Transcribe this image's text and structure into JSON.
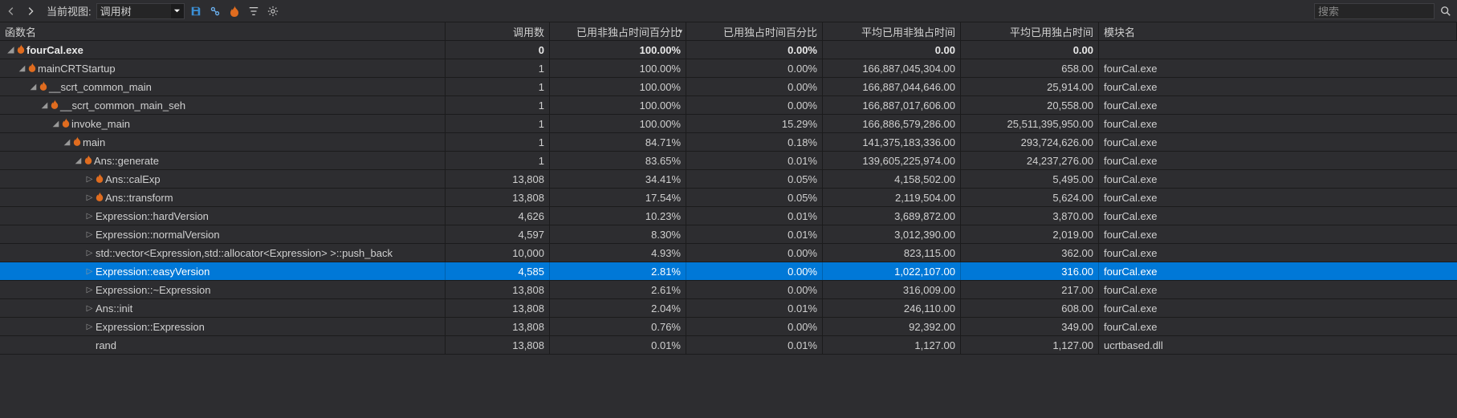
{
  "toolbar": {
    "view_label": "当前视图:",
    "view_value": "调用树",
    "search_placeholder": "搜索"
  },
  "columns": {
    "fn": "函数名",
    "calls": "调用数",
    "elap": "已用非独占时间百分比",
    "excl": "已用独占时间百分比",
    "avel": "平均已用非独占时间",
    "avex": "平均已用独占时间",
    "mod": "模块名"
  },
  "rows": [
    {
      "depth": 0,
      "exp": "open",
      "fire": true,
      "fn": "fourCal.exe",
      "calls": "0",
      "elap": "100.00%",
      "excl": "0.00%",
      "avel": "0.00",
      "avex": "0.00",
      "mod": "",
      "top": true
    },
    {
      "depth": 1,
      "exp": "open",
      "fire": true,
      "fn": "mainCRTStartup",
      "calls": "1",
      "elap": "100.00%",
      "excl": "0.00%",
      "avel": "166,887,045,304.00",
      "avex": "658.00",
      "mod": "fourCal.exe"
    },
    {
      "depth": 2,
      "exp": "open",
      "fire": true,
      "fn": "__scrt_common_main",
      "calls": "1",
      "elap": "100.00%",
      "excl": "0.00%",
      "avel": "166,887,044,646.00",
      "avex": "25,914.00",
      "mod": "fourCal.exe"
    },
    {
      "depth": 3,
      "exp": "open",
      "fire": true,
      "fn": "__scrt_common_main_seh",
      "calls": "1",
      "elap": "100.00%",
      "excl": "0.00%",
      "avel": "166,887,017,606.00",
      "avex": "20,558.00",
      "mod": "fourCal.exe"
    },
    {
      "depth": 4,
      "exp": "open",
      "fire": true,
      "fn": "invoke_main",
      "calls": "1",
      "elap": "100.00%",
      "excl": "15.29%",
      "avel": "166,886,579,286.00",
      "avex": "25,511,395,950.00",
      "mod": "fourCal.exe"
    },
    {
      "depth": 5,
      "exp": "open",
      "fire": true,
      "fn": "main",
      "calls": "1",
      "elap": "84.71%",
      "excl": "0.18%",
      "avel": "141,375,183,336.00",
      "avex": "293,724,626.00",
      "mod": "fourCal.exe"
    },
    {
      "depth": 6,
      "exp": "open",
      "fire": true,
      "fn": "Ans::generate",
      "calls": "1",
      "elap": "83.65%",
      "excl": "0.01%",
      "avel": "139,605,225,974.00",
      "avex": "24,237,276.00",
      "mod": "fourCal.exe"
    },
    {
      "depth": 7,
      "exp": "closed",
      "fire": true,
      "fn": "Ans::calExp",
      "calls": "13,808",
      "elap": "34.41%",
      "excl": "0.05%",
      "avel": "4,158,502.00",
      "avex": "5,495.00",
      "mod": "fourCal.exe"
    },
    {
      "depth": 7,
      "exp": "closed",
      "fire": true,
      "fn": "Ans::transform",
      "calls": "13,808",
      "elap": "17.54%",
      "excl": "0.05%",
      "avel": "2,119,504.00",
      "avex": "5,624.00",
      "mod": "fourCal.exe"
    },
    {
      "depth": 7,
      "exp": "closed",
      "fire": false,
      "fn": "Expression::hardVersion",
      "calls": "4,626",
      "elap": "10.23%",
      "excl": "0.01%",
      "avel": "3,689,872.00",
      "avex": "3,870.00",
      "mod": "fourCal.exe"
    },
    {
      "depth": 7,
      "exp": "closed",
      "fire": false,
      "fn": "Expression::normalVersion",
      "calls": "4,597",
      "elap": "8.30%",
      "excl": "0.01%",
      "avel": "3,012,390.00",
      "avex": "2,019.00",
      "mod": "fourCal.exe"
    },
    {
      "depth": 7,
      "exp": "closed",
      "fire": false,
      "fn": "std::vector<Expression,std::allocator<Expression> >::push_back",
      "calls": "10,000",
      "elap": "4.93%",
      "excl": "0.00%",
      "avel": "823,115.00",
      "avex": "362.00",
      "mod": "fourCal.exe"
    },
    {
      "depth": 7,
      "exp": "closed",
      "fire": false,
      "fn": "Expression::easyVersion",
      "calls": "4,585",
      "elap": "2.81%",
      "excl": "0.00%",
      "avel": "1,022,107.00",
      "avex": "316.00",
      "mod": "fourCal.exe",
      "selected": true
    },
    {
      "depth": 7,
      "exp": "closed",
      "fire": false,
      "fn": "Expression::~Expression",
      "calls": "13,808",
      "elap": "2.61%",
      "excl": "0.00%",
      "avel": "316,009.00",
      "avex": "217.00",
      "mod": "fourCal.exe"
    },
    {
      "depth": 7,
      "exp": "closed",
      "fire": false,
      "fn": "Ans::init",
      "calls": "13,808",
      "elap": "2.04%",
      "excl": "0.01%",
      "avel": "246,110.00",
      "avex": "608.00",
      "mod": "fourCal.exe"
    },
    {
      "depth": 7,
      "exp": "closed",
      "fire": false,
      "fn": "Expression::Expression",
      "calls": "13,808",
      "elap": "0.76%",
      "excl": "0.00%",
      "avel": "92,392.00",
      "avex": "349.00",
      "mod": "fourCal.exe"
    },
    {
      "depth": 7,
      "exp": "none",
      "fire": false,
      "fn": "rand",
      "calls": "13,808",
      "elap": "0.01%",
      "excl": "0.01%",
      "avel": "1,127.00",
      "avex": "1,127.00",
      "mod": "ucrtbased.dll"
    }
  ]
}
